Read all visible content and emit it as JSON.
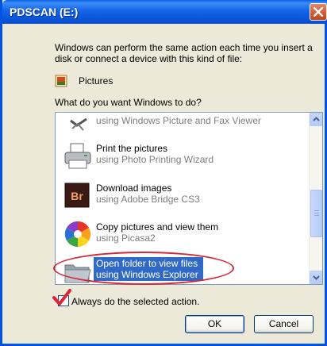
{
  "window": {
    "title": "PDSCAN (E:)"
  },
  "intro_text": "Windows can perform the same action each time you insert a disk or connect a device with this kind of file:",
  "content_type": {
    "label": "Pictures",
    "icon": "pictures-icon"
  },
  "question": "What do you want Windows to do?",
  "actions": [
    {
      "title": "",
      "subtitle": "using Windows Picture and Fax Viewer",
      "icon": "picture-fax-viewer-icon"
    },
    {
      "title": "Print the pictures",
      "subtitle": "using Photo Printing Wizard",
      "icon": "printer-icon"
    },
    {
      "title": "Download images",
      "subtitle": "using Adobe Bridge CS3",
      "icon": "adobe-bridge-icon",
      "icon_text": "Br"
    },
    {
      "title": "Copy pictures and view them",
      "subtitle": "using Picasa2",
      "icon": "picasa-icon"
    },
    {
      "title": "Open folder to view files",
      "subtitle": "using Windows Explorer",
      "icon": "folder-icon"
    }
  ],
  "selected_action_index": 4,
  "always_checkbox": {
    "label": "Always do the selected action.",
    "checked": true
  },
  "buttons": {
    "ok": "OK",
    "cancel": "Cancel"
  },
  "colors": {
    "titlebar": "#0a54d8",
    "selection": "#316ac5",
    "annotation": "#d6263a"
  }
}
